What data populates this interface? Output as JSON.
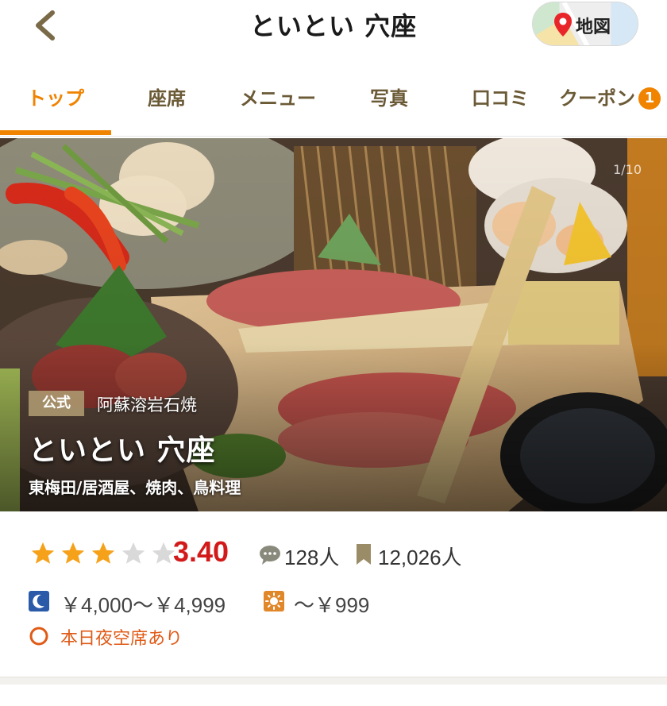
{
  "header": {
    "title": "といとい 穴座",
    "map_button_label": "地図"
  },
  "tabs": [
    {
      "label": "トップ",
      "active": true
    },
    {
      "label": "座席",
      "active": false
    },
    {
      "label": "メニュー",
      "active": false
    },
    {
      "label": "写真",
      "active": false
    },
    {
      "label": "口コミ",
      "active": false
    },
    {
      "label": "クーポン",
      "active": false,
      "badge": "1"
    }
  ],
  "hero": {
    "counter": "1/10",
    "official_badge": "公式",
    "genre": "阿蘇溶岩石焼",
    "shop_name": "といとい 穴座",
    "area_category": "東梅田/居酒屋、焼肉、鳥料理"
  },
  "rating": {
    "stars_filled": 3,
    "stars_total": 5,
    "score": "3.40",
    "review_count": "128",
    "review_unit": "人",
    "bookmark_count": "12,026",
    "bookmark_unit": "人"
  },
  "price": {
    "dinner": "￥4,000～￥4,999",
    "lunch": "～￥999"
  },
  "vacancy": {
    "text": "本日夜空席あり"
  },
  "colors": {
    "accent": "#f08300",
    "score": "#d21a1a",
    "tab_text": "#6b5a36",
    "vacancy": "#e05a16",
    "star_filled": "#f5a11a",
    "star_empty": "#d9d9d9",
    "dinner_icon": "#2a5aa8",
    "lunch_icon": "#e0872a"
  },
  "icons": [
    "back-chevron-icon",
    "map-pin-icon",
    "star-icon",
    "comment-icon",
    "bookmark-icon",
    "moon-icon",
    "sun-icon",
    "circle-icon"
  ]
}
